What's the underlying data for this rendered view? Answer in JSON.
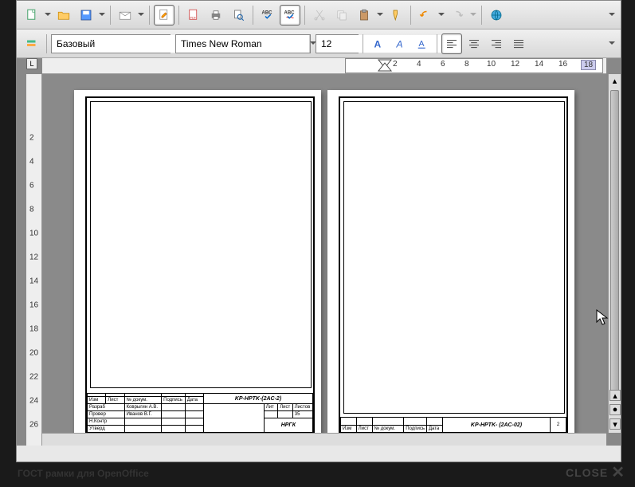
{
  "toolbar1": {
    "style_combo": "Базовый",
    "font_combo": "Times New Roman",
    "size_combo": "12"
  },
  "ruler_h": [
    "2",
    "4",
    "6",
    "8",
    "10",
    "12",
    "14",
    "16",
    "18"
  ],
  "ruler_v": [
    "2",
    "4",
    "6",
    "8",
    "10",
    "12",
    "14",
    "16",
    "18",
    "20",
    "22",
    "24",
    "26"
  ],
  "page1": {
    "doc_code": "KP-HPTK-(2AC-2)",
    "org": "НРГК",
    "row1a": "Изм",
    "row1b": "Лист",
    "row1c": "№ докум.",
    "row1d": "Подпись",
    "row1e": "Дата",
    "row2a": "Разраб",
    "row2b": "Коврыгин А.В.",
    "row3a": "Провер",
    "row3b": "Иванов В.Г.",
    "row4a": "Н.Контр",
    "row5a": "Утверд",
    "lit": "Лит",
    "list": "Лист",
    "listov": "Листов",
    "listval": "35"
  },
  "page2": {
    "doc_code": "KP-HPTK- (2AC-02)",
    "c1": "Изм",
    "c2": "Лист",
    "c3": "№ докум.",
    "c4": "Подпись",
    "c5": "Дата",
    "sheet": "2"
  },
  "caption": "ГОСТ рамки для OpenOffice",
  "close_label": "CLOSE"
}
